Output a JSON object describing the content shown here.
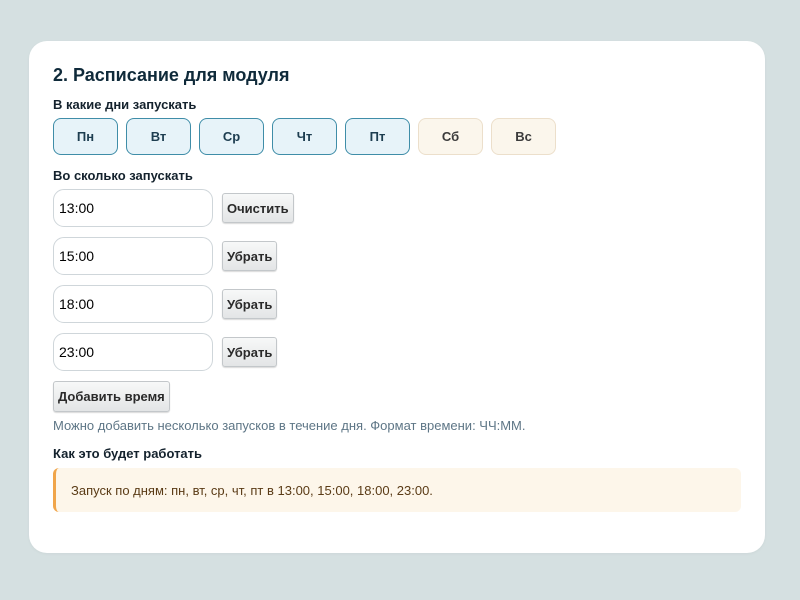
{
  "section": {
    "title": "2. Расписание для модуля",
    "days_label": "В какие дни запускать",
    "days": [
      {
        "label": "Пн",
        "selected": true
      },
      {
        "label": "Вт",
        "selected": true
      },
      {
        "label": "Ср",
        "selected": true
      },
      {
        "label": "Чт",
        "selected": true
      },
      {
        "label": "Пт",
        "selected": true
      },
      {
        "label": "Сб",
        "selected": false
      },
      {
        "label": "Вс",
        "selected": false
      }
    ],
    "times_label": "Во сколько запускать",
    "times": [
      {
        "value": "13:00",
        "action": "Очистить"
      },
      {
        "value": "15:00",
        "action": "Убрать"
      },
      {
        "value": "18:00",
        "action": "Убрать"
      },
      {
        "value": "23:00",
        "action": "Убрать"
      }
    ],
    "add_time_label": "Добавить время",
    "hint": "Можно добавить несколько запусков в течение дня. Формат времени: ЧЧ:ММ.",
    "how_label": "Как это будет работать",
    "summary": "Запуск по дням: пн, вт, ср, чт, пт в 13:00, 15:00, 18:00, 23:00."
  },
  "colors": {
    "background": "#d5e0e1",
    "day_selected_border": "#3f8da8",
    "day_selected_bg": "#e7f3f9",
    "day_unselected_bg": "#fbf6ec",
    "notice_accent": "#f0a54a",
    "notice_bg": "#fdf6ea"
  }
}
